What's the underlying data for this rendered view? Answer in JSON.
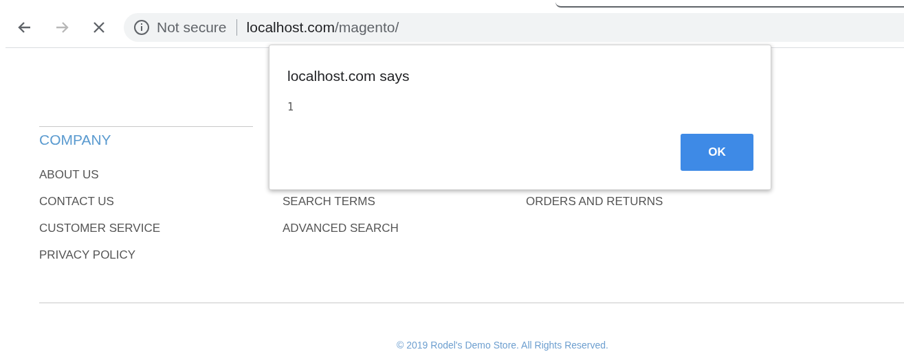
{
  "browser": {
    "nav_buttons": [
      {
        "kind": "back",
        "disabled": false
      },
      {
        "kind": "forward",
        "disabled": true
      },
      {
        "kind": "stop",
        "disabled": false
      }
    ],
    "security_label": "Not secure",
    "url_host": "localhost.com",
    "url_path": "/magento/"
  },
  "footer": {
    "columns": [
      {
        "heading": "COMPANY",
        "links": [
          "ABOUT US",
          "CONTACT US",
          "CUSTOMER SERVICE",
          "PRIVACY POLICY"
        ]
      },
      {
        "links": [
          "SEARCH TERMS",
          "ADVANCED SEARCH"
        ]
      },
      {
        "links": [
          "ORDERS AND RETURNS"
        ]
      }
    ],
    "copyright": "© 2019 Rodel's Demo Store. All Rights Reserved."
  },
  "dialog": {
    "title": "localhost.com says",
    "message": "1",
    "button": "OK"
  }
}
